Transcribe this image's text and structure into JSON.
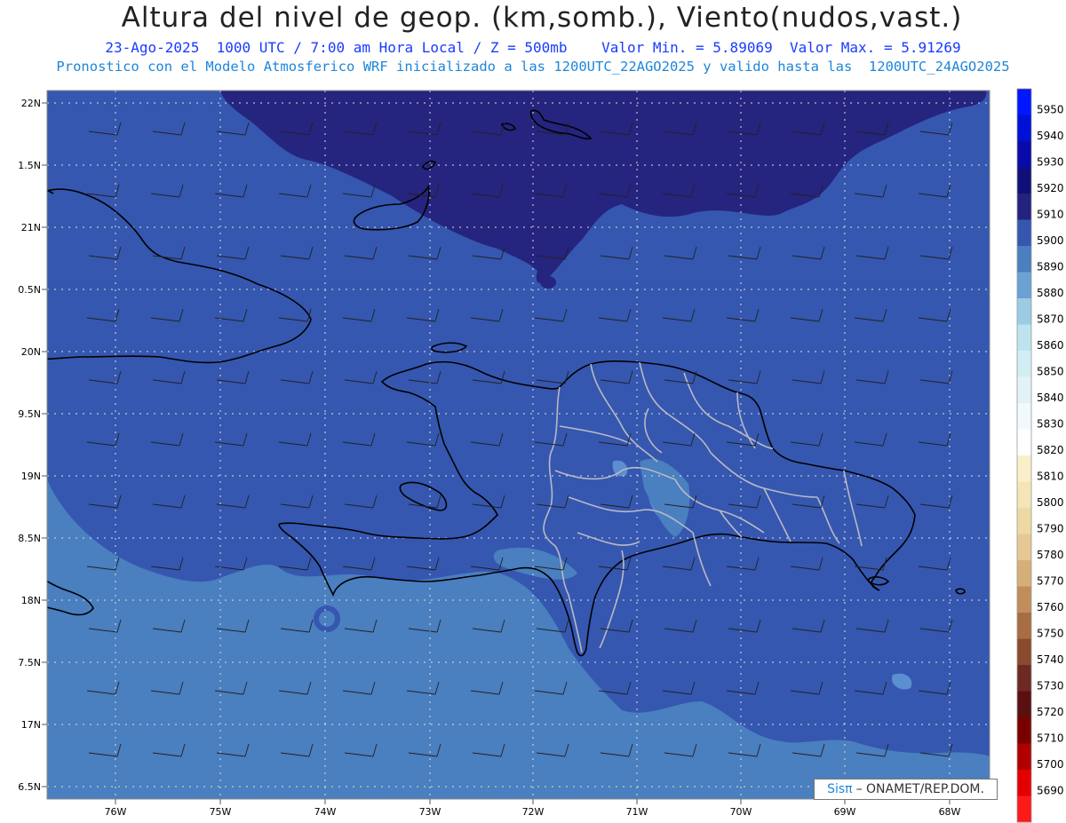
{
  "header": {
    "title": "Altura del nivel de geop. (km,somb.), Viento(nudos,vast.)",
    "subtitle1": "23-Ago-2025  1000 UTC / 7:00 am Hora Local / Z = 500mb    Valor Min. = 5.89069  Valor Max. = 5.91269",
    "subtitle2": "Pronostico con el Modelo Atmosferico WRF inicializado a las 1200UTC_22AGO2025 y valido hasta las  1200UTC_24AGO2025"
  },
  "map": {
    "lat_labels": [
      "22N",
      "1.5N",
      "21N",
      "0.5N",
      "20N",
      "9.5N",
      "19N",
      "8.5N",
      "18N",
      "7.5N",
      "17N",
      "6.5N"
    ],
    "lon_labels": [
      "76W",
      "75W",
      "74W",
      "73W",
      "72W",
      "71W",
      "70W",
      "69W",
      "68W"
    ],
    "colors": {
      "band_5890": "#4a7fc0",
      "band_5900": "#3557b0",
      "band_5910": "#25247f",
      "band_5880": "#5b8fd0",
      "coast": "#000000",
      "provinces": "#b9b9c3",
      "grid": "#e0e0e0"
    }
  },
  "colorbar": {
    "levels": [
      "5950",
      "5940",
      "5930",
      "5920",
      "5910",
      "5900",
      "5890",
      "5880",
      "5870",
      "5860",
      "5850",
      "5840",
      "5830",
      "5820",
      "5810",
      "5800",
      "5790",
      "5780",
      "5770",
      "5760",
      "5750",
      "5740",
      "5730",
      "5720",
      "5710",
      "5700",
      "5690"
    ],
    "colors": [
      "#0017ff",
      "#0010d6",
      "#0a0aa8",
      "#101078",
      "#23237f",
      "#3557b0",
      "#4a7fc0",
      "#6aa2d6",
      "#9ccbe4",
      "#bde3ee",
      "#d2edf4",
      "#e2f3f7",
      "#f0f9fb",
      "#ffffff",
      "#f9efc8",
      "#f4e4b6",
      "#eed9a4",
      "#e6c895",
      "#d6ae7a",
      "#c18e5a",
      "#a86d42",
      "#8a4a2e",
      "#6e2a22",
      "#5a1010",
      "#7a0000",
      "#b00000",
      "#e40000",
      "#ff1a1a"
    ]
  },
  "credit": {
    "sis": "Sisπ",
    "text": "– ONAMET/REP.DOM."
  }
}
